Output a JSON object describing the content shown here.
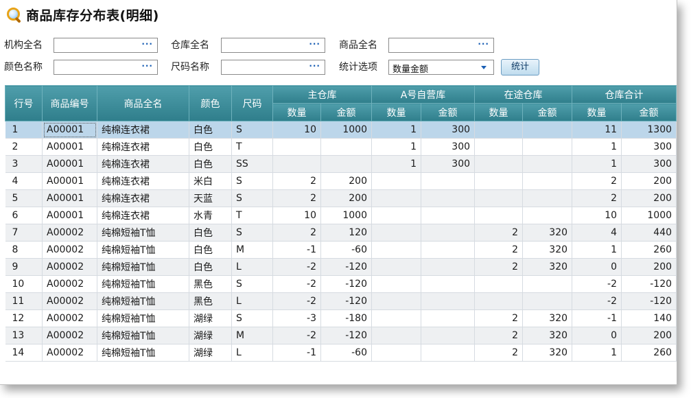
{
  "title": "商品库存分布表(明细)",
  "filters": {
    "org_label": "机构全名",
    "warehouse_label": "仓库全名",
    "product_label": "商品全名",
    "color_label": "颜色名称",
    "size_label": "尺码名称",
    "stat_label": "统计选项",
    "stat_value": "数量金额",
    "ellipsis": "···",
    "button": "统计"
  },
  "grid": {
    "headers": {
      "row_no": "行号",
      "code": "商品编号",
      "name": "商品全名",
      "color": "颜色",
      "size": "尺码",
      "groups": [
        "主仓库",
        "A号自营库",
        "在途仓库",
        "仓库合计"
      ],
      "qty": "数量",
      "amt": "金额"
    },
    "rows": [
      {
        "no": "1",
        "code": "A00001",
        "name": "纯棉连衣裙",
        "color": "白色",
        "size": "S",
        "m_q": "10",
        "m_a": "1000",
        "a_q": "1",
        "a_a": "300",
        "t_q": "",
        "t_a": "",
        "s_q": "11",
        "s_a": "1300"
      },
      {
        "no": "2",
        "code": "A00001",
        "name": "纯棉连衣裙",
        "color": "白色",
        "size": "T",
        "m_q": "",
        "m_a": "",
        "a_q": "1",
        "a_a": "300",
        "t_q": "",
        "t_a": "",
        "s_q": "1",
        "s_a": "300"
      },
      {
        "no": "3",
        "code": "A00001",
        "name": "纯棉连衣裙",
        "color": "白色",
        "size": "SS",
        "m_q": "",
        "m_a": "",
        "a_q": "1",
        "a_a": "300",
        "t_q": "",
        "t_a": "",
        "s_q": "1",
        "s_a": "300"
      },
      {
        "no": "4",
        "code": "A00001",
        "name": "纯棉连衣裙",
        "color": "米白",
        "size": "S",
        "m_q": "2",
        "m_a": "200",
        "a_q": "",
        "a_a": "",
        "t_q": "",
        "t_a": "",
        "s_q": "2",
        "s_a": "200"
      },
      {
        "no": "5",
        "code": "A00001",
        "name": "纯棉连衣裙",
        "color": "天蓝",
        "size": "S",
        "m_q": "2",
        "m_a": "200",
        "a_q": "",
        "a_a": "",
        "t_q": "",
        "t_a": "",
        "s_q": "2",
        "s_a": "200"
      },
      {
        "no": "6",
        "code": "A00001",
        "name": "纯棉连衣裙",
        "color": "水青",
        "size": "T",
        "m_q": "10",
        "m_a": "1000",
        "a_q": "",
        "a_a": "",
        "t_q": "",
        "t_a": "",
        "s_q": "10",
        "s_a": "1000"
      },
      {
        "no": "7",
        "code": "A00002",
        "name": "纯棉短袖T恤",
        "color": "白色",
        "size": "S",
        "m_q": "2",
        "m_a": "120",
        "a_q": "",
        "a_a": "",
        "t_q": "2",
        "t_a": "320",
        "s_q": "4",
        "s_a": "440"
      },
      {
        "no": "8",
        "code": "A00002",
        "name": "纯棉短袖T恤",
        "color": "白色",
        "size": "M",
        "m_q": "-1",
        "m_a": "-60",
        "a_q": "",
        "a_a": "",
        "t_q": "2",
        "t_a": "320",
        "s_q": "1",
        "s_a": "260"
      },
      {
        "no": "9",
        "code": "A00002",
        "name": "纯棉短袖T恤",
        "color": "白色",
        "size": "L",
        "m_q": "-2",
        "m_a": "-120",
        "a_q": "",
        "a_a": "",
        "t_q": "2",
        "t_a": "320",
        "s_q": "0",
        "s_a": "200"
      },
      {
        "no": "10",
        "code": "A00002",
        "name": "纯棉短袖T恤",
        "color": "黑色",
        "size": "S",
        "m_q": "-2",
        "m_a": "-120",
        "a_q": "",
        "a_a": "",
        "t_q": "",
        "t_a": "",
        "s_q": "-2",
        "s_a": "-120"
      },
      {
        "no": "11",
        "code": "A00002",
        "name": "纯棉短袖T恤",
        "color": "黑色",
        "size": "L",
        "m_q": "-2",
        "m_a": "-120",
        "a_q": "",
        "a_a": "",
        "t_q": "",
        "t_a": "",
        "s_q": "-2",
        "s_a": "-120"
      },
      {
        "no": "12",
        "code": "A00002",
        "name": "纯棉短袖T恤",
        "color": "湖绿",
        "size": "S",
        "m_q": "-3",
        "m_a": "-180",
        "a_q": "",
        "a_a": "",
        "t_q": "2",
        "t_a": "320",
        "s_q": "-1",
        "s_a": "140"
      },
      {
        "no": "13",
        "code": "A00002",
        "name": "纯棉短袖T恤",
        "color": "湖绿",
        "size": "M",
        "m_q": "-2",
        "m_a": "-120",
        "a_q": "",
        "a_a": "",
        "t_q": "2",
        "t_a": "320",
        "s_q": "0",
        "s_a": "200"
      },
      {
        "no": "14",
        "code": "A00002",
        "name": "纯棉短袖T恤",
        "color": "湖绿",
        "size": "L",
        "m_q": "-1",
        "m_a": "-60",
        "a_q": "",
        "a_a": "",
        "t_q": "2",
        "t_a": "320",
        "s_q": "1",
        "s_a": "260"
      }
    ]
  },
  "colors": {
    "header": "#2f7e8b",
    "selected_row": "#bcd6ea",
    "alt_row": "#eef0f2"
  }
}
